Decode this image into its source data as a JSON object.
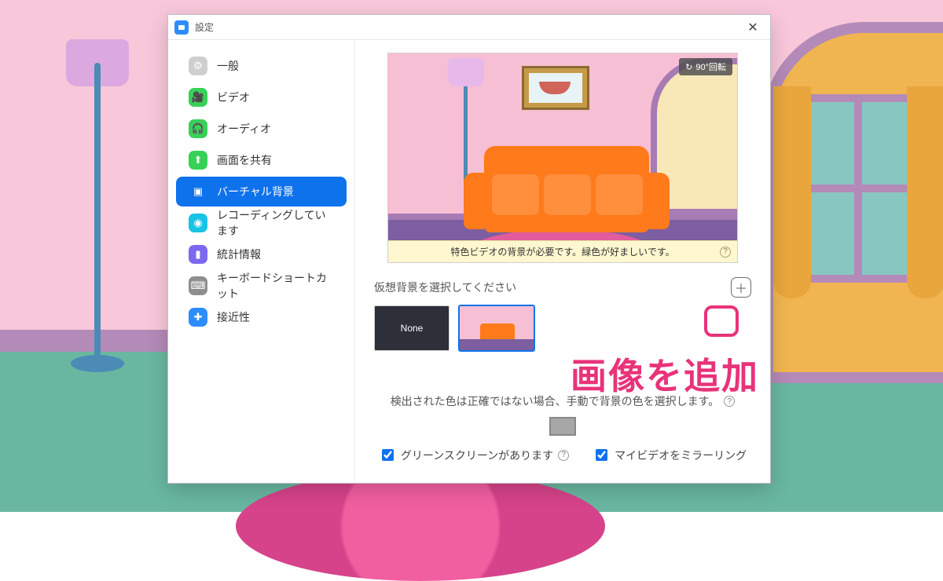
{
  "window": {
    "title": "設定"
  },
  "sidebar": {
    "items": [
      {
        "label": "一般"
      },
      {
        "label": "ビデオ"
      },
      {
        "label": "オーディオ"
      },
      {
        "label": "画面を共有"
      },
      {
        "label": "バーチャル背景"
      },
      {
        "label": "レコーディングしています"
      },
      {
        "label": "統計情報"
      },
      {
        "label": "キーボードショートカット"
      },
      {
        "label": "接近性"
      }
    ],
    "active_index": 4
  },
  "preview": {
    "rotate_label": "90°回転",
    "info_text": "特色ビデオの背景が必要です。緑色が好ましいです。"
  },
  "select": {
    "label": "仮想背景を選択してください"
  },
  "thumbs": {
    "none_label": "None",
    "selected_index": 1
  },
  "detect": {
    "text": "検出された色は正確ではない場合、手動で背景の色を選択します。"
  },
  "checks": {
    "greenscreen": "グリーンスクリーンがあります",
    "mirror": "マイビデオをミラーリング"
  },
  "annotation": {
    "text": "画像を追加"
  }
}
